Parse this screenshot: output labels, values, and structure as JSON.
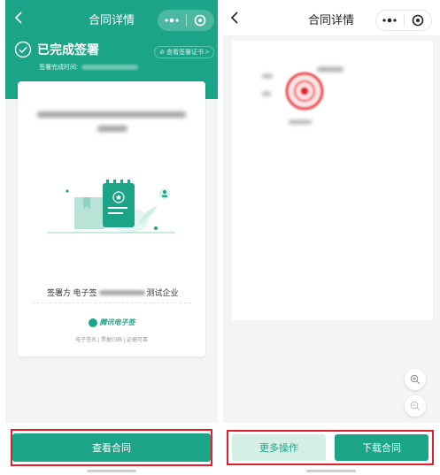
{
  "left": {
    "nav_title": "合同详情",
    "status_title": "已完成签署",
    "cert_link": "⊘ 查看签署证书 >",
    "sign_time_label": "签署完成时间:",
    "signer_prefix": "签署方  电子签",
    "signer_suffix": "测试企业",
    "brand_name": "腾讯电子签",
    "brand_tagline": "电子签名 | 票据归档 | 证据可靠",
    "view_button": "查看合同"
  },
  "right": {
    "nav_title": "合同详情",
    "more_button": "更多操作",
    "download_button": "下载合同"
  },
  "colors": {
    "brand": "#1ba487",
    "highlight": "#e0202a"
  },
  "icons": [
    "chevron-left-icon",
    "more-dots-icon",
    "record-icon",
    "check-circle-icon",
    "zoom-in-icon",
    "zoom-out-icon",
    "stamp-icon"
  ]
}
